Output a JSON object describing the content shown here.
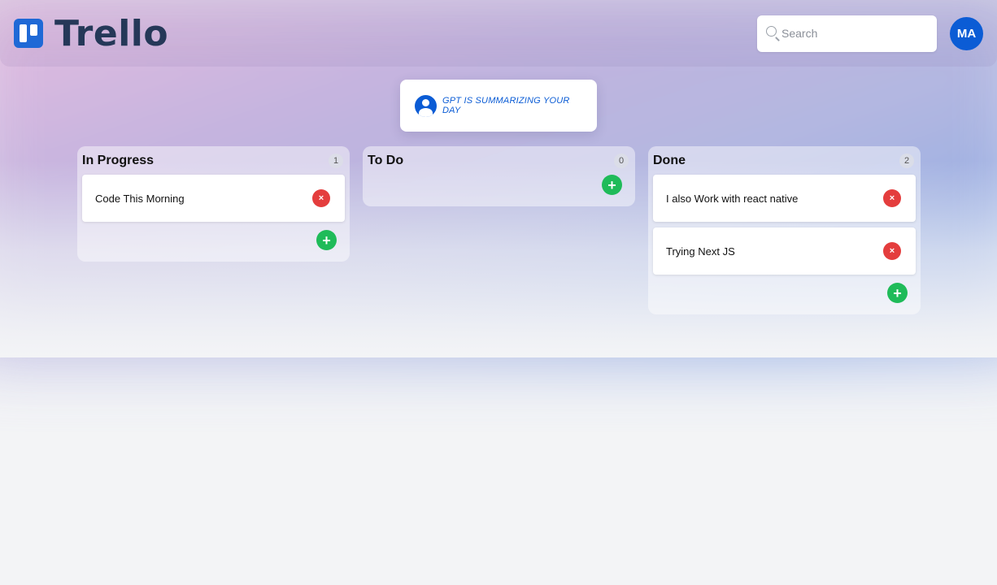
{
  "app": {
    "name": "Trello"
  },
  "search": {
    "placeholder": "Search"
  },
  "user": {
    "initials": "MA"
  },
  "summary": {
    "text": "GPT IS SUMMARIZING YOUR DAY"
  },
  "columns": [
    {
      "title": "In Progress",
      "count": "1",
      "cards": [
        "Code This Morning"
      ]
    },
    {
      "title": "To Do",
      "count": "0",
      "cards": []
    },
    {
      "title": "Done",
      "count": "2",
      "cards": [
        "I also Work with react native",
        "Trying Next JS"
      ]
    }
  ],
  "icons": {
    "remove": "×",
    "add": "+"
  },
  "colors": {
    "brand": "#0b5cd5",
    "remove": "#e43d3d",
    "add": "#1fbb59",
    "logo_text": "#253858"
  }
}
